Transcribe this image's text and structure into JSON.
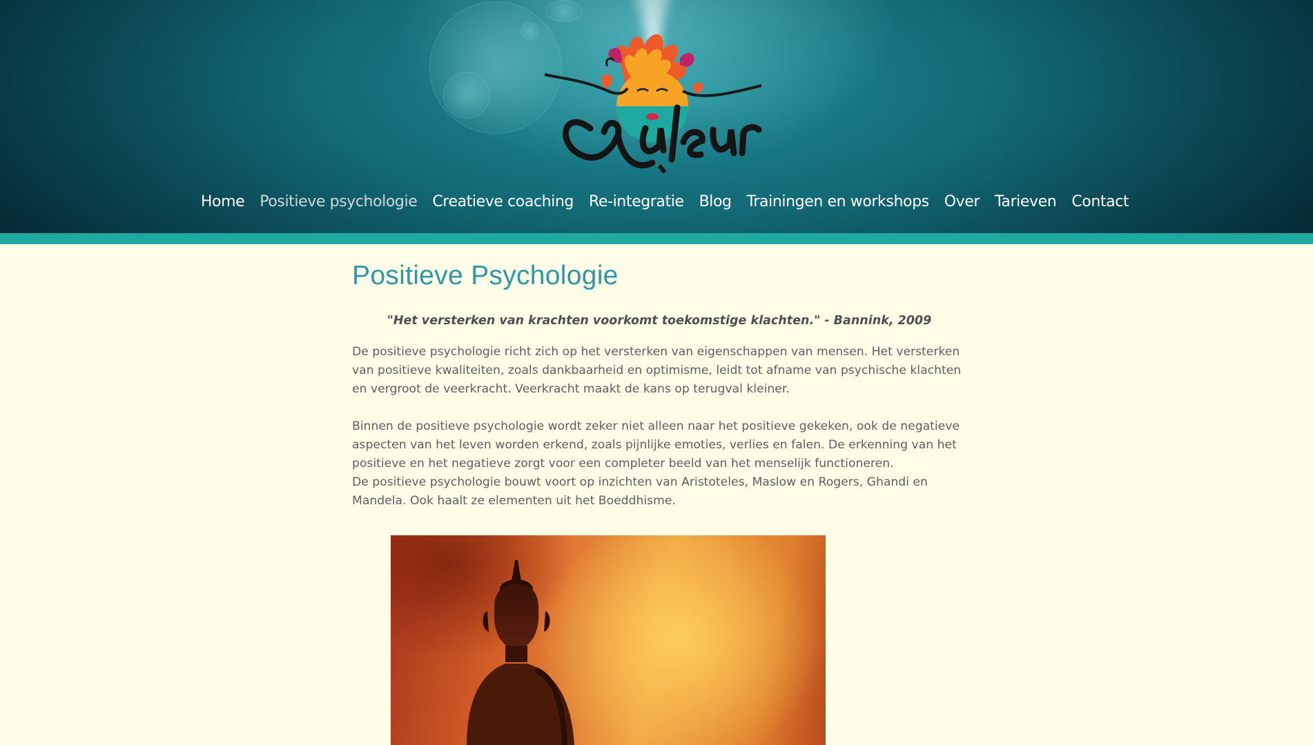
{
  "site": {
    "logo_text": "valeur"
  },
  "nav": {
    "items": [
      {
        "label": "Home",
        "active": false
      },
      {
        "label": "Positieve psychologie",
        "active": true
      },
      {
        "label": "Creatieve coaching",
        "active": false
      },
      {
        "label": "Re-integratie",
        "active": false
      },
      {
        "label": "Blog",
        "active": false
      },
      {
        "label": "Trainingen en workshops",
        "active": false
      },
      {
        "label": "Over",
        "active": false
      },
      {
        "label": "Tarieven",
        "active": false
      },
      {
        "label": "Contact",
        "active": false
      }
    ]
  },
  "main": {
    "title": "Positieve Psychologie",
    "quote": "\"Het versterken van krachten voorkomt toekomstige klachten.\" - Bannink, 2009",
    "paragraphs": [
      "De positieve psychologie richt zich op het versterken van eigenschappen van mensen. Het versterken van positieve kwaliteiten, zoals dankbaarheid en optimisme, leidt tot afname van psychische klachten en vergroot de veerkracht. Veerkracht maakt de kans op terugval kleiner.",
      "Binnen de positieve psychologie wordt zeker niet alleen naar het positieve gekeken, ook de negatieve aspecten van het leven worden erkend, zoals pijnlijke emoties, verlies en falen. De erkenning van het positieve en het negatieve zorgt voor een completer beeld van het menselijk functioneren.",
      "De positieve psychologie bouwt voort op inzichten van Aristoteles, Maslow en Rogers, Ghandi en Mandela. Ook haalt ze elementen uit het Boeddhisme."
    ]
  },
  "colors": {
    "accent_teal": "#2f98a6",
    "stripe": "#1ea9a1",
    "background": "#fefee8",
    "body_text": "#5e5e5e"
  },
  "icons": {
    "logo": "sun-face-logo",
    "photo": "buddha-statue-image"
  }
}
